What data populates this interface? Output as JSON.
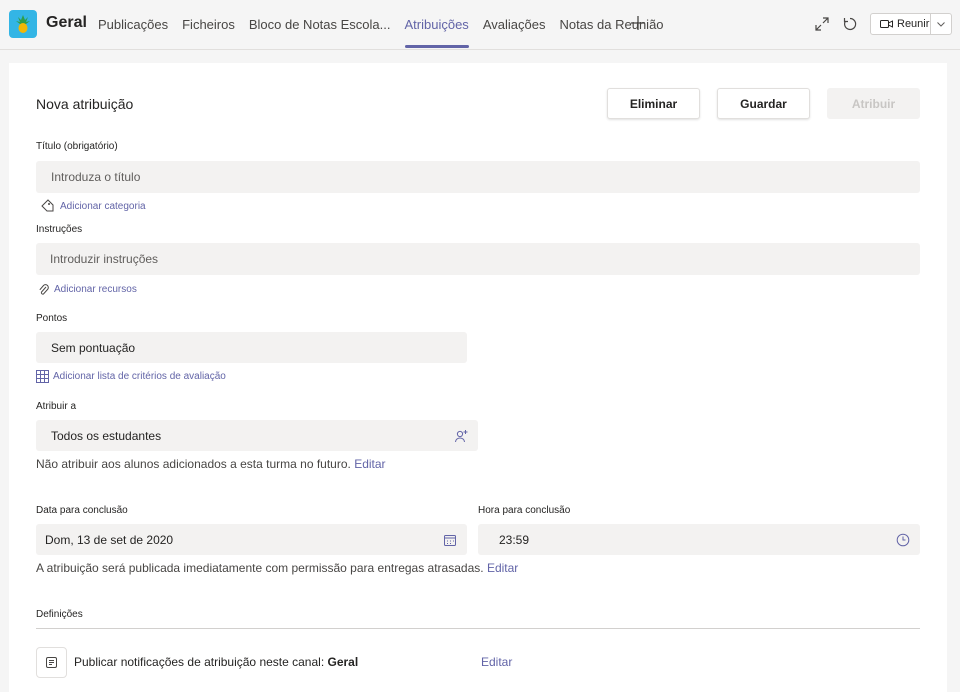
{
  "header": {
    "team_name": "Geral",
    "tabs": [
      {
        "label": "Publicações"
      },
      {
        "label": "Ficheiros"
      },
      {
        "label": "Bloco de Notas Escola..."
      },
      {
        "label": "Atribuições",
        "active": true
      },
      {
        "label": "Avaliações"
      },
      {
        "label": "Notas da Reunião"
      }
    ],
    "meet_label": "Reunir",
    "accent": "#6264a7"
  },
  "form": {
    "title": "Nova atribuição",
    "buttons": {
      "delete": "Eliminar",
      "save": "Guardar",
      "assign": "Atribuir"
    },
    "title_label": "Título (obrigatório)",
    "title_placeholder": "Introduza o título",
    "add_category": "Adicionar categoria",
    "instructions_label": "Instruções",
    "instructions_placeholder": "Introduzir instruções",
    "add_resources": "Adicionar recursos",
    "points_label": "Pontos",
    "points_value": "Sem pontuação",
    "add_rubric": "Adicionar lista de critérios de avaliação",
    "assign_to_label": "Atribuir a",
    "assign_to_value": "Todos os estudantes",
    "future_students_note": "Não atribuir aos alunos adicionados a esta turma no futuro.",
    "edit_link": "Editar",
    "due_date_label": "Data para conclusão",
    "due_date_value": "Dom, 13 de set de 2020",
    "due_time_label": "Hora para conclusão",
    "due_time_value": "23:59",
    "publish_note": "A atribuição será publicada imediatamente com permissão para entregas atrasadas.",
    "settings_label": "Definições",
    "notify_text": "Publicar notificações de atribuição neste canal:",
    "notify_channel": "Geral"
  }
}
